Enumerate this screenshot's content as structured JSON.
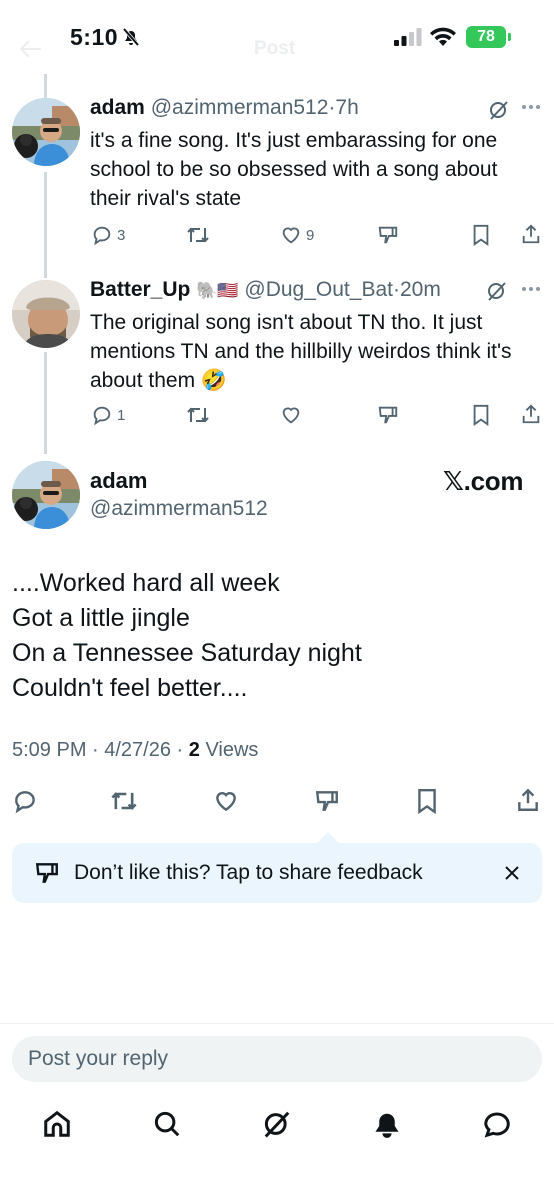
{
  "status": {
    "time": "5:10",
    "battery": "78"
  },
  "header": {
    "title": "Post"
  },
  "replies": [
    {
      "name": "adam",
      "handle": "@azimmerman512",
      "time": "·7h",
      "text": "it's a fine song. It's just embarassing for one school to be so obsessed with a song about their rival's state",
      "reply_count": "3",
      "like_count": "9"
    },
    {
      "name": "Batter_Up",
      "badges": "🐘🇺🇸",
      "handle": "@Dug_Out_Bat",
      "time": "·20m",
      "text": "The original song isn't about TN tho. It just mentions TN and the hillbilly weirdos think it's about them 🤣",
      "reply_count": "1",
      "like_count": ""
    }
  ],
  "main_post": {
    "name": "adam",
    "handle": "@azimmerman512",
    "watermark": "𝕏.com",
    "lines": [
      "....Worked hard all week",
      "Got a little jingle",
      "On a Tennessee Saturday night",
      "Couldn't feel better...."
    ],
    "timestamp": "5:09 PM · 4/27/26 · ",
    "views_count": "2",
    "views_label": " Views"
  },
  "feedback": {
    "text": "Don’t like this? Tap to share feedback"
  },
  "composer": {
    "placeholder": "Post your reply"
  },
  "icons": [
    "bell-slash-icon",
    "signal-icon",
    "wifi-icon",
    "battery-icon",
    "reply-icon",
    "repost-icon",
    "like-icon",
    "dislike-icon",
    "bookmark-icon",
    "share-icon",
    "grok-icon",
    "more-icon",
    "close-icon",
    "home-icon",
    "search-icon",
    "notifications-icon",
    "messages-icon"
  ],
  "colors": {
    "text": "#0f1419",
    "secondary": "#536471",
    "battery": "#34c759",
    "feedback_bg": "#eaf5fd"
  }
}
